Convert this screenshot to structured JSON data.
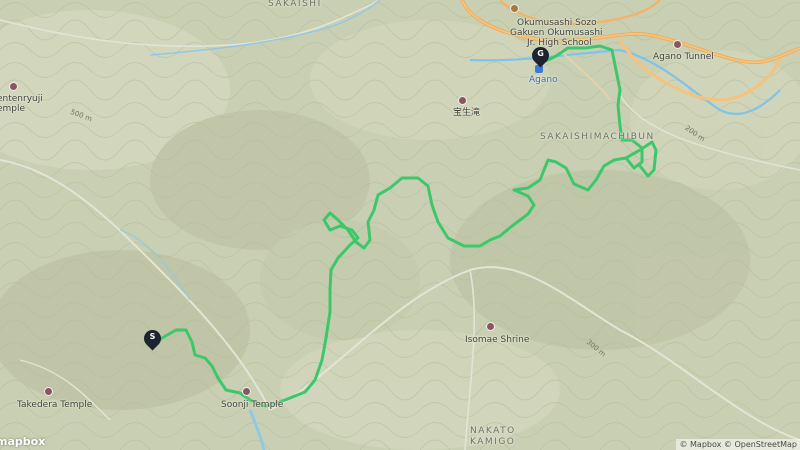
{
  "map": {
    "place_labels": [
      {
        "id": "sakaishi",
        "text": "SAKAISHI"
      },
      {
        "id": "sakaishimachibun",
        "text": "SAKAISHIMACHIBUN"
      },
      {
        "id": "nakato-kamigo-1",
        "text": "NAKATO"
      },
      {
        "id": "nakato-kamigo-2",
        "text": "KAMIGO"
      }
    ],
    "poi_labels": [
      {
        "id": "school-1",
        "text": "Okumusashi Sozo"
      },
      {
        "id": "school-2",
        "text": "Gakuen Okumusashi"
      },
      {
        "id": "school-3",
        "text": "Jr. High School"
      },
      {
        "id": "agano",
        "text": "Agano"
      },
      {
        "id": "agano-tunnel",
        "text": "Agano Tunnel"
      },
      {
        "id": "kanji",
        "text": "宝生滝"
      },
      {
        "id": "tenryuji-1",
        "text": "entenryuji"
      },
      {
        "id": "tenryuji-2",
        "text": "emple"
      },
      {
        "id": "isomae-shrine",
        "text": "Isomae Shrine"
      },
      {
        "id": "takedera-temple",
        "text": "Takedera Temple"
      },
      {
        "id": "soonji-temple",
        "text": "Soonji Temple"
      }
    ],
    "elevation_labels": [
      "500 m",
      "200 m",
      "300 m"
    ],
    "markers": {
      "start": "S",
      "goal": "G"
    },
    "logo": "mapbox",
    "attribution": "© Mapbox © OpenStreetMap",
    "colors": {
      "terrain": "#c9cfb2",
      "route": "#3cc86a",
      "highway": "#f4b860",
      "river": "#7fc3e8",
      "marker": "#1d2330",
      "poi": "#8a5662"
    }
  }
}
